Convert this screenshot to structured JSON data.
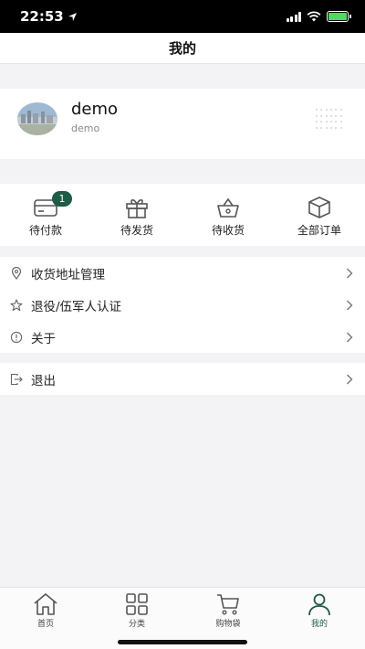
{
  "status_bar": {
    "time": "22:53"
  },
  "header": {
    "title": "我的"
  },
  "profile": {
    "name": "demo",
    "subtitle": "demo"
  },
  "orders": [
    {
      "label": "待付款",
      "icon": "card-icon",
      "badge": "1"
    },
    {
      "label": "待发货",
      "icon": "gift-box-icon"
    },
    {
      "label": "待收货",
      "icon": "basket-icon"
    },
    {
      "label": "全部订单",
      "icon": "package-icon"
    }
  ],
  "menu": [
    {
      "label": "收货地址管理",
      "icon": "location-pin-icon"
    },
    {
      "label": "退役/伍军人认证",
      "icon": "star-icon"
    },
    {
      "label": "关于",
      "icon": "info-icon"
    }
  ],
  "logout": {
    "label": "退出",
    "icon": "logout-icon"
  },
  "tabbar": [
    {
      "label": "首页",
      "icon": "home-icon"
    },
    {
      "label": "分类",
      "icon": "grid-icon"
    },
    {
      "label": "购物袋",
      "icon": "cart-icon"
    },
    {
      "label": "我的",
      "icon": "user-icon",
      "active": true
    }
  ],
  "colors": {
    "accent": "#1f5c45",
    "page_bg": "#f3f3f5",
    "card_bg": "#ffffff"
  }
}
